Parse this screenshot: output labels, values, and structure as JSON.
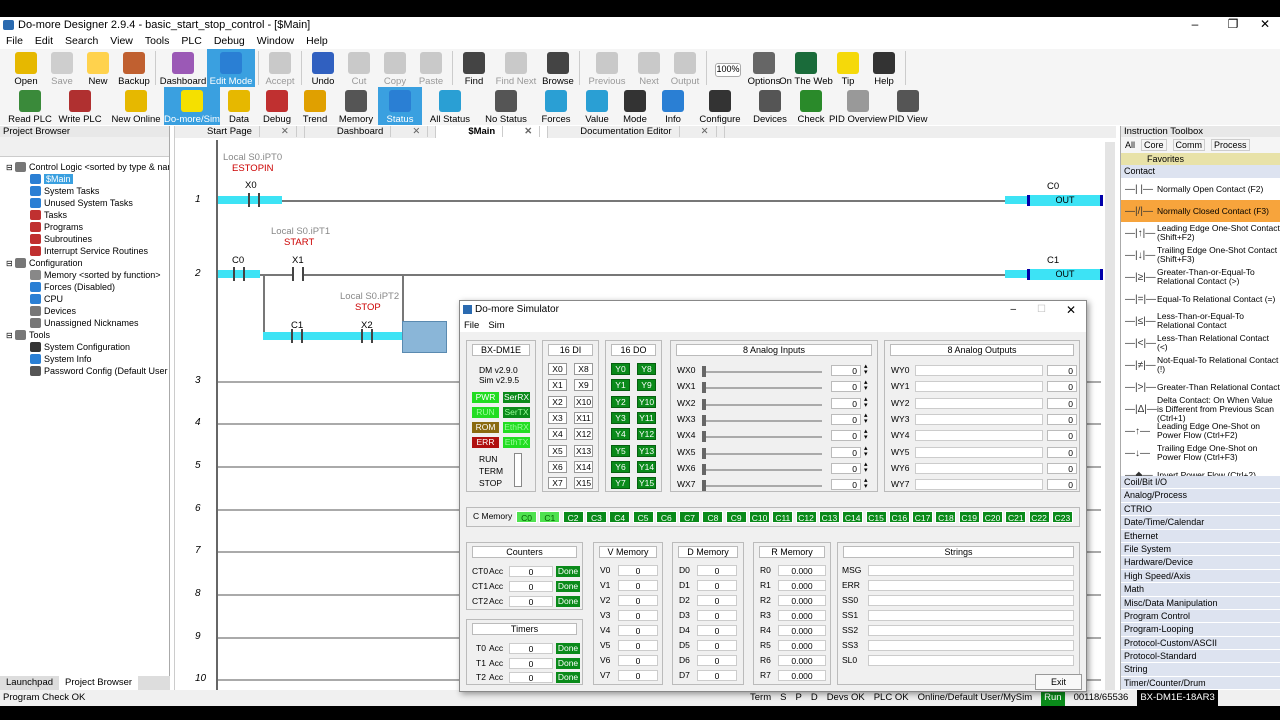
{
  "window": {
    "title": "Do-more Designer 2.9.4 - basic_start_stop_control - [$Main]"
  },
  "menu": [
    "File",
    "Edit",
    "Search",
    "View",
    "Tools",
    "PLC",
    "Debug",
    "Window",
    "Help"
  ],
  "toolbar1": [
    {
      "label": "Open",
      "icon": "open-folder-icon",
      "color": "#e6b800",
      "dis": false
    },
    {
      "label": "Save",
      "icon": "save-icon",
      "color": "#888",
      "dis": true
    },
    {
      "label": "New",
      "icon": "new-document-icon",
      "color": "#ffd24d",
      "dis": false
    },
    {
      "label": "Backup",
      "icon": "backup-icon",
      "color": "#c06030",
      "dis": false
    },
    {
      "label": "Dashboard",
      "icon": "dashboard-icon",
      "color": "#9b59b6",
      "dis": false
    },
    {
      "label": "Edit Mode",
      "icon": "edit-mode-icon",
      "color": "#2a7fd4",
      "dis": false,
      "on": true
    },
    {
      "label": "Accept",
      "icon": "accept-icon",
      "color": "#777",
      "dis": true
    },
    {
      "label": "Undo",
      "icon": "undo-icon",
      "color": "#3060c0",
      "dis": false
    },
    {
      "label": "Cut",
      "icon": "cut-icon",
      "color": "#777",
      "dis": true
    },
    {
      "label": "Copy",
      "icon": "copy-icon",
      "color": "#777",
      "dis": true
    },
    {
      "label": "Paste",
      "icon": "paste-icon",
      "color": "#777",
      "dis": true
    },
    {
      "label": "Find",
      "icon": "find-icon",
      "color": "#444",
      "dis": false
    },
    {
      "label": "Find Next",
      "icon": "find-next-icon",
      "color": "#777",
      "dis": true
    },
    {
      "label": "Browse",
      "icon": "browse-icon",
      "color": "#444",
      "dis": false
    },
    {
      "label": "Previous",
      "icon": "previous-icon",
      "color": "#777",
      "dis": true
    },
    {
      "label": "Next",
      "icon": "next-icon",
      "color": "#777",
      "dis": true
    },
    {
      "label": "Output",
      "icon": "output-icon",
      "color": "#777",
      "dis": true
    },
    {
      "label": "100%",
      "icon": "zoom-select-icon",
      "color": "#fff",
      "dis": false
    },
    {
      "label": "Options",
      "icon": "options-icon",
      "color": "#666",
      "dis": false
    },
    {
      "label": "On The Web",
      "icon": "web-icon",
      "color": "#1a6b3a",
      "dis": false
    },
    {
      "label": "Tip",
      "icon": "tip-lightbulb-icon",
      "color": "#f5d90a",
      "dis": false
    },
    {
      "label": "Help",
      "icon": "help-icon",
      "color": "#333",
      "dis": false
    }
  ],
  "toolbar2": [
    {
      "label": "Read PLC",
      "icon": "read-plc-icon",
      "color": "#3a8a3a"
    },
    {
      "label": "Write PLC",
      "icon": "write-plc-icon",
      "color": "#b03030"
    },
    {
      "label": "New Online",
      "icon": "new-online-icon",
      "color": "#e6b800"
    },
    {
      "label": "Do-more/Sim",
      "icon": "do-more-sim-icon",
      "color": "#f5e000",
      "on": true
    },
    {
      "label": "Data",
      "icon": "data-icon",
      "color": "#e6b800"
    },
    {
      "label": "Debug",
      "icon": "debug-icon",
      "color": "#c03030"
    },
    {
      "label": "Trend",
      "icon": "trend-icon",
      "color": "#e0a000"
    },
    {
      "label": "Memory",
      "icon": "memory-icon",
      "color": "#555"
    },
    {
      "label": "Status",
      "icon": "status-icon",
      "color": "#2a7fd4",
      "on": true
    },
    {
      "label": "All Status",
      "icon": "all-status-icon",
      "color": "#2a9fd4"
    },
    {
      "label": "No Status",
      "icon": "no-status-icon",
      "color": "#555"
    },
    {
      "label": "Forces",
      "icon": "forces-icon",
      "color": "#2a9fd4"
    },
    {
      "label": "Value",
      "icon": "value-icon",
      "color": "#2a9fd4"
    },
    {
      "label": "Mode",
      "icon": "mode-traffic-light-icon",
      "color": "#333"
    },
    {
      "label": "Info",
      "icon": "info-icon",
      "color": "#2a7fd4"
    },
    {
      "label": "Configure",
      "icon": "configure-xy-icon",
      "color": "#333"
    },
    {
      "label": "Devices",
      "icon": "devices-icon",
      "color": "#555"
    },
    {
      "label": "Check",
      "icon": "check-icon",
      "color": "#2a8a2a"
    },
    {
      "label": "PID Overview",
      "icon": "pid-overview-icon",
      "color": "#999"
    },
    {
      "label": "PID View",
      "icon": "pid-view-icon",
      "color": "#555"
    }
  ],
  "project_browser": {
    "title": "Project Browser",
    "items": [
      {
        "label": "Control Logic <sorted by type & name>",
        "indent": 0,
        "color": "#777"
      },
      {
        "label": "$Main",
        "indent": 2,
        "color": "#2a7fd4",
        "sel": true
      },
      {
        "label": "System Tasks",
        "indent": 2,
        "color": "#2a7fd4"
      },
      {
        "label": "Unused System Tasks",
        "indent": 2,
        "color": "#2a7fd4"
      },
      {
        "label": "Tasks",
        "indent": 2,
        "color": "#c03030"
      },
      {
        "label": "Programs",
        "indent": 2,
        "color": "#c03030"
      },
      {
        "label": "Subroutines",
        "indent": 2,
        "color": "#c03030"
      },
      {
        "label": "Interrupt Service Routines",
        "indent": 2,
        "color": "#c03030"
      },
      {
        "label": "Configuration",
        "indent": 0,
        "color": "#777"
      },
      {
        "label": "Memory <sorted by function>",
        "indent": 2,
        "color": "#888"
      },
      {
        "label": "Forces (Disabled)",
        "indent": 2,
        "color": "#2a7fd4"
      },
      {
        "label": "CPU",
        "indent": 2,
        "color": "#2a7fd4"
      },
      {
        "label": "Devices",
        "indent": 2,
        "color": "#777"
      },
      {
        "label": "Unassigned Nicknames",
        "indent": 2,
        "color": "#777"
      },
      {
        "label": "Tools",
        "indent": 0,
        "color": "#777"
      },
      {
        "label": "System Configuration",
        "indent": 2,
        "color": "#333"
      },
      {
        "label": "System Info",
        "indent": 2,
        "color": "#2a7fd4"
      },
      {
        "label": "Password Config (Default User - R",
        "indent": 2,
        "color": "#555"
      }
    ],
    "tabs": [
      "Launchpad",
      "Project Browser"
    ]
  },
  "doc_tabs": [
    "Start Page",
    "Dashboard",
    "$Main",
    "Documentation Editor"
  ],
  "ladder": {
    "rung_numbers": [
      "1",
      "2",
      "3",
      "4",
      "5",
      "6",
      "7",
      "8",
      "9",
      "10"
    ],
    "r1": {
      "nick": "Local S0.iPT0",
      "nick_name": "ESTOPIN",
      "contact": "X0",
      "coil": "C0",
      "coil_label": "OUT"
    },
    "r2": {
      "nick1": "Local S0.iPT1",
      "nick1_name": "START",
      "contact1": "C0",
      "contact2": "X1",
      "nick2": "Local S0.iPT2",
      "nick2_name": "STOP",
      "contact3": "C1",
      "contact4": "X2",
      "coil": "C1",
      "coil_label": "OUT"
    }
  },
  "toolbox": {
    "title": "Instruction Toolbox",
    "filters": [
      "All",
      "Core",
      "Comm",
      "Process"
    ],
    "favorites": "Favorites",
    "contact_header": "Contact",
    "items": [
      {
        "glyph": "—| |—",
        "label": "Normally Open Contact (F2)"
      },
      {
        "glyph": "—|/|—",
        "label": "Normally Closed Contact (F3)",
        "sel": true
      },
      {
        "glyph": "—|↑|—",
        "label": "Leading Edge One-Shot Contact (Shift+F2)"
      },
      {
        "glyph": "—|↓|—",
        "label": "Trailing Edge One-Shot Contact (Shift+F3)"
      },
      {
        "glyph": "—|≥|—",
        "label": "Greater-Than-or-Equal-To Relational Contact (>)"
      },
      {
        "glyph": "—|=|—",
        "label": "Equal-To Relational Contact (=)"
      },
      {
        "glyph": "—|≤|—",
        "label": "Less-Than-or-Equal-To Relational Contact"
      },
      {
        "glyph": "—|<|—",
        "label": "Less-Than Relational Contact (<)"
      },
      {
        "glyph": "—|≠|—",
        "label": "Not-Equal-To Relational Contact (!)"
      },
      {
        "glyph": "—|>|—",
        "label": "Greater-Than Relational Contact"
      },
      {
        "glyph": "—|Δ|—",
        "label": "Delta Contact: On When Value is Different from Previous Scan (Ctrl+1)"
      },
      {
        "glyph": "—↑—",
        "label": "Leading Edge One-Shot on Power Flow (Ctrl+F2)"
      },
      {
        "glyph": "—↓—",
        "label": "Trailing Edge One-Shot on Power Flow (Ctrl+F3)"
      },
      {
        "glyph": "—◆—",
        "label": "Invert Power Flow (Ctrl+2)"
      }
    ],
    "categories": [
      "Coil/Bit I/O",
      "Analog/Process",
      "CTRIO",
      "Date/Time/Calendar",
      "Ethernet",
      "File System",
      "Hardware/Device",
      "High Speed/Axis",
      "Math",
      "Misc/Data Manipulation",
      "Program Control",
      "Program-Looping",
      "Protocol-Custom/ASCII",
      "Protocol-Standard",
      "String",
      "Timer/Counter/Drum"
    ]
  },
  "simulator": {
    "title": "Do-more Simulator",
    "menu": [
      "File",
      "Sim"
    ],
    "model": "BX-DM1E",
    "ver1": "DM v2.9.0",
    "ver2": "Sim v2.9.5",
    "leds": [
      [
        "PWR",
        "SerRX"
      ],
      [
        "RUN",
        "SerTX"
      ],
      [
        "ROM",
        "EthRX"
      ],
      [
        "ERR",
        "EthTX"
      ]
    ],
    "switch": [
      "RUN",
      "TERM",
      "STOP"
    ],
    "di_title": "16 DI",
    "di": [
      "X0",
      "X8",
      "X1",
      "X9",
      "X2",
      "X10",
      "X3",
      "X11",
      "X4",
      "X12",
      "X5",
      "X13",
      "X6",
      "X14",
      "X7",
      "X15"
    ],
    "do_title": "16 DO",
    "do": [
      "Y0",
      "Y8",
      "Y1",
      "Y9",
      "Y2",
      "Y10",
      "Y3",
      "Y11",
      "Y4",
      "Y12",
      "Y5",
      "Y13",
      "Y6",
      "Y14",
      "Y7",
      "Y15"
    ],
    "ai_title": "8 Analog Inputs",
    "ai": [
      {
        "n": "WX0",
        "v": "0"
      },
      {
        "n": "WX1",
        "v": "0"
      },
      {
        "n": "WX2",
        "v": "0"
      },
      {
        "n": "WX3",
        "v": "0"
      },
      {
        "n": "WX4",
        "v": "0"
      },
      {
        "n": "WX5",
        "v": "0"
      },
      {
        "n": "WX6",
        "v": "0"
      },
      {
        "n": "WX7",
        "v": "0"
      }
    ],
    "ao_title": "8 Analog Outputs",
    "ao": [
      {
        "n": "WY0",
        "v": "0"
      },
      {
        "n": "WY1",
        "v": "0"
      },
      {
        "n": "WY2",
        "v": "0"
      },
      {
        "n": "WY3",
        "v": "0"
      },
      {
        "n": "WY4",
        "v": "0"
      },
      {
        "n": "WY5",
        "v": "0"
      },
      {
        "n": "WY6",
        "v": "0"
      },
      {
        "n": "WY7",
        "v": "0"
      }
    ],
    "cmem_label": "C Memory",
    "cmem": [
      "C0",
      "C1",
      "C2",
      "C3",
      "C4",
      "C5",
      "C6",
      "C7",
      "C8",
      "C9",
      "C10",
      "C11",
      "C12",
      "C13",
      "C14",
      "C15",
      "C16",
      "C17",
      "C18",
      "C19",
      "C20",
      "C21",
      "C22",
      "C23"
    ],
    "counters_title": "Counters",
    "counters": [
      {
        "n": "CT0",
        "acc": "Acc",
        "v": "0",
        "s": "Done"
      },
      {
        "n": "CT1",
        "acc": "Acc",
        "v": "0",
        "s": "Done"
      },
      {
        "n": "CT2",
        "acc": "Acc",
        "v": "0",
        "s": "Done"
      }
    ],
    "timers_title": "Timers",
    "timers": [
      {
        "n": "T0",
        "acc": "Acc",
        "v": "0",
        "s": "Done"
      },
      {
        "n": "T1",
        "acc": "Acc",
        "v": "0",
        "s": "Done"
      },
      {
        "n": "T2",
        "acc": "Acc",
        "v": "0",
        "s": "Done"
      }
    ],
    "vmem_title": "V Memory",
    "vmem": [
      {
        "n": "V0",
        "v": "0"
      },
      {
        "n": "V1",
        "v": "0"
      },
      {
        "n": "V2",
        "v": "0"
      },
      {
        "n": "V3",
        "v": "0"
      },
      {
        "n": "V4",
        "v": "0"
      },
      {
        "n": "V5",
        "v": "0"
      },
      {
        "n": "V6",
        "v": "0"
      },
      {
        "n": "V7",
        "v": "0"
      }
    ],
    "dmem_title": "D Memory",
    "dmem": [
      {
        "n": "D0",
        "v": "0"
      },
      {
        "n": "D1",
        "v": "0"
      },
      {
        "n": "D2",
        "v": "0"
      },
      {
        "n": "D3",
        "v": "0"
      },
      {
        "n": "D4",
        "v": "0"
      },
      {
        "n": "D5",
        "v": "0"
      },
      {
        "n": "D6",
        "v": "0"
      },
      {
        "n": "D7",
        "v": "0"
      }
    ],
    "rmem_title": "R Memory",
    "rmem": [
      {
        "n": "R0",
        "v": "0.000"
      },
      {
        "n": "R1",
        "v": "0.000"
      },
      {
        "n": "R2",
        "v": "0.000"
      },
      {
        "n": "R3",
        "v": "0.000"
      },
      {
        "n": "R4",
        "v": "0.000"
      },
      {
        "n": "R5",
        "v": "0.000"
      },
      {
        "n": "R6",
        "v": "0.000"
      },
      {
        "n": "R7",
        "v": "0.000"
      }
    ],
    "strings_title": "Strings",
    "strings": [
      "MSG",
      "ERR",
      "SS0",
      "SS1",
      "SS2",
      "SS3",
      "SL0"
    ],
    "exit": "Exit"
  },
  "statusbar": {
    "left": "Program Check OK",
    "items": [
      "Term",
      "S",
      "P",
      "D",
      "Devs OK",
      "PLC OK",
      "Online/Default User/MySim",
      "Run",
      "00118/65536",
      "BX-DM1E-18AR3"
    ]
  },
  "colors": {
    "accent": "#3aa0e0",
    "power_flow": "#3de3f5",
    "io_on": "#0a8a1a",
    "io_hi": "#4ee14e",
    "selected": "#f7a43c"
  }
}
